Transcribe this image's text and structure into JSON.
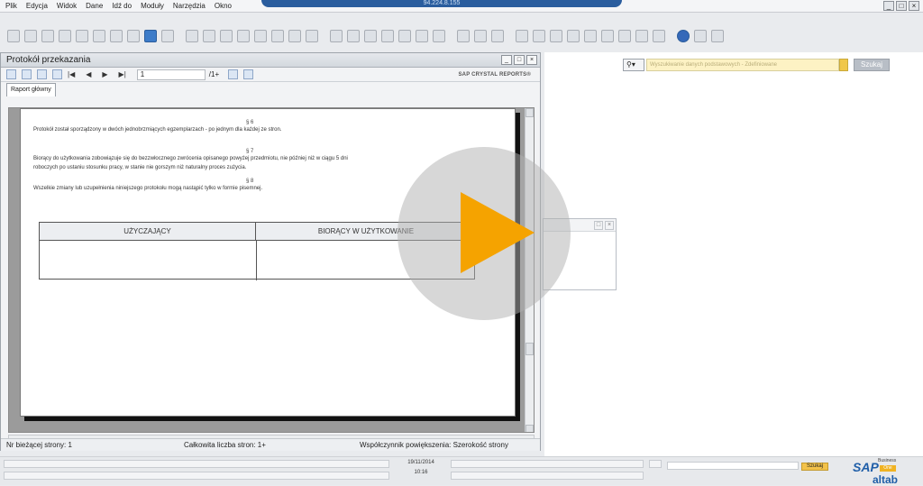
{
  "app": {
    "title_bar": "94.224.8.155",
    "window_buttons": [
      "_",
      "□",
      "×"
    ]
  },
  "menu": [
    "Plik",
    "Edycja",
    "Widok",
    "Dane",
    "Idź do",
    "Moduły",
    "Narzędzia",
    "Okno"
  ],
  "report_window": {
    "title": "Protokół przekazania",
    "page_value": "1",
    "page_total": "/1+",
    "brand": "SAP CRYSTAL REPORTS®",
    "tab": "Raport główny",
    "nav": [
      "|◀",
      "◀",
      "▶",
      "▶|"
    ],
    "zoom_icon": "binoculars-icon"
  },
  "document": {
    "s6_heading": "§ 6",
    "s6_text": "Protokół został sporządzony w dwóch jednobrzmiących egzemplarzach - po jednym dla każdej ze stron.",
    "s7_heading": "§ 7",
    "s7_text_1": "Biorący do użytkowania zobowiązuje się do bezzwłocznego zwrócenia opisanego powyżej przedmiotu, nie później niż w ciągu 5 dni",
    "s7_text_2": "roboczych po ustaniu stosunku pracy, w stanie nie gorszym niż naturalny proces zużycia.",
    "s8_heading": "§ 8",
    "s8_text": "Wszelkie zmiany lub uzupełnienia niniejszego protokołu mogą nastąpić tylko w formie pisemnej.",
    "signature_left": "UŻYCZAJĄCY",
    "signature_right": "BIORĄCY W UŻYTKOWANIE"
  },
  "status_bar": {
    "current_page": "Nr bieżącej strony: 1",
    "total_pages": "Całkowita liczba stron: 1+",
    "zoom": "Współczynnik powiększenia: Szerokość strony"
  },
  "search": {
    "placeholder": "Wyszukiwanie danych podstawowych - Zdefiniowane",
    "button": "Szukaj"
  },
  "footer": {
    "date": "19/11/2014",
    "time": "10:16",
    "search_button": "Szukaj",
    "logo_sap": "SAP",
    "logo_business": "Business",
    "logo_one": "One",
    "logo_alt": "altab"
  },
  "colors": {
    "accent_blue": "#2a5d9e",
    "play_orange": "#f5a300",
    "search_yellow": "#fdf2c4"
  }
}
